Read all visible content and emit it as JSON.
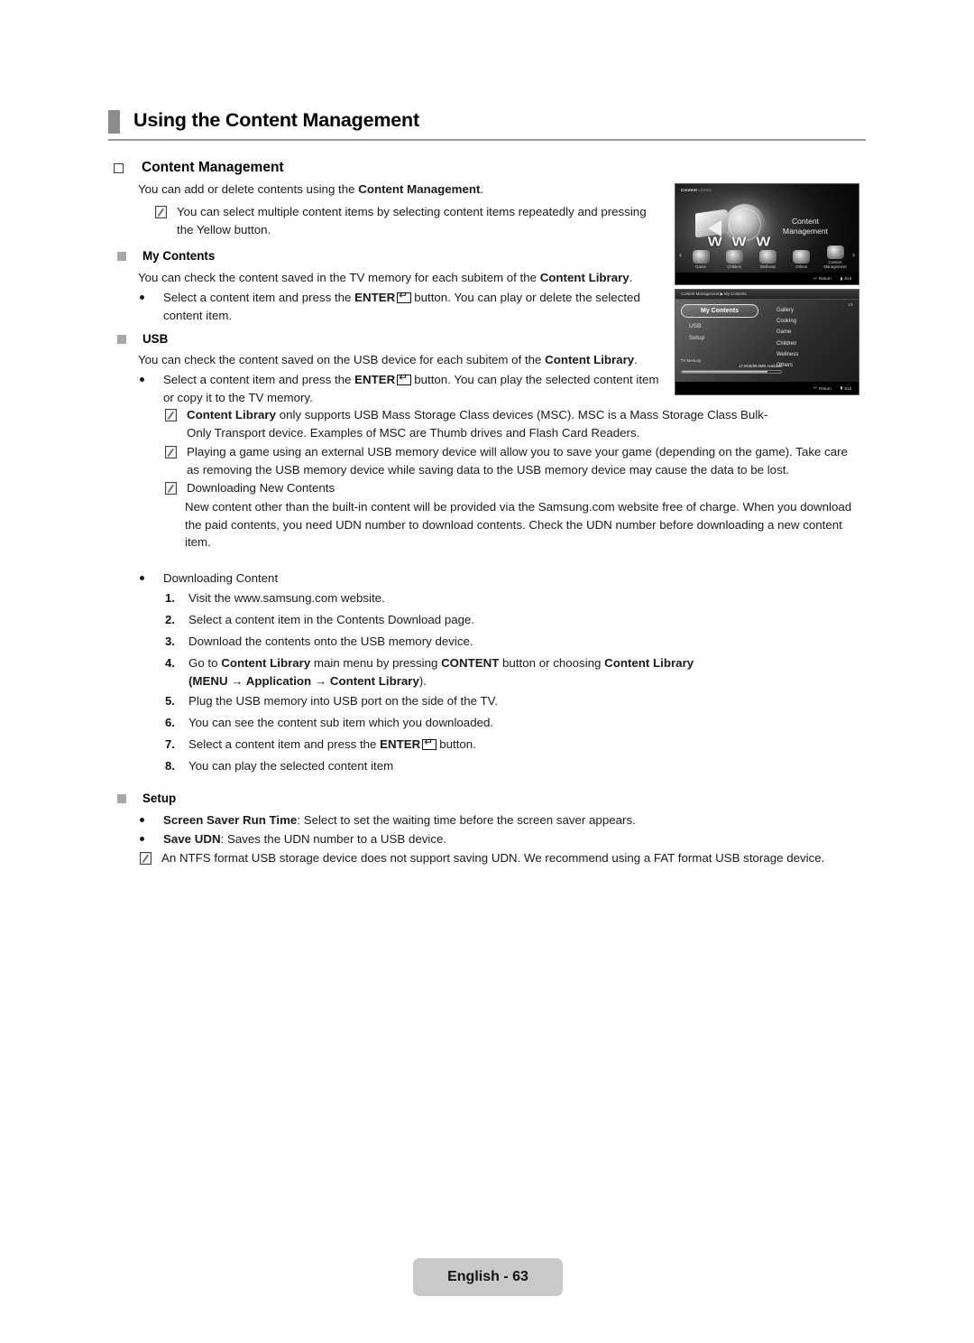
{
  "document": {
    "title": "Using the Content Management",
    "footer_label": "English - 63"
  },
  "section": {
    "heading": "Content Management",
    "intro_prefix": "You can add or delete contents using the ",
    "intro_bold": "Content Management",
    "intro_suffix": ".",
    "note1": "You can select multiple content items by selecting content items repeatedly and pressing the Yellow button."
  },
  "my_contents": {
    "heading": "My Contents",
    "desc_prefix": "You can check the content saved in the TV memory for each subitem of the ",
    "desc_bold": "Content Library",
    "desc_suffix": ".",
    "bullet_pre": "Select a content item and press the ",
    "bullet_enter": "ENTER",
    "bullet_post": "button. You can play or delete the selected content item."
  },
  "usb": {
    "heading": "USB",
    "desc_prefix": "You can check the content saved on the USB device for each subitem of the ",
    "desc_bold": "Content Library",
    "desc_suffix": ".",
    "bullet_pre": "Select a content item and press the ",
    "bullet_enter": "ENTER",
    "bullet_post": "button. You can play the selected content item or copy it to the TV memory.",
    "note_msc_bold": "Content Library",
    "note_msc": " only supports USB Mass Storage Class devices (MSC). MSC is a Mass Storage Class Bulk-Only Transport device. Examples of MSC are Thumb drives and Flash Card Readers.",
    "note_game": "Playing a game using an external USB memory device will allow you to save your game (depending on the game). Take care as removing the USB memory device while saving data to the USB memory device may cause the data to be lost.",
    "note_download_title": "Downloading New Contents",
    "note_download_body": "New content other than the built-in content will be provided via the Samsung.com website free of charge. When you download the paid contents, you need UDN number to download contents. Check the UDN number before downloading a new content item."
  },
  "downloading": {
    "bullet_label": "Downloading Content",
    "steps": [
      {
        "n": "1.",
        "text": "Visit the www.samsung.com website."
      },
      {
        "n": "2.",
        "text": "Select a content item in the Contents Download page."
      },
      {
        "n": "3.",
        "text": "Download the contents onto the USB memory device."
      },
      {
        "n": "4.",
        "text": ""
      },
      {
        "n": "5.",
        "text": "Plug the USB memory into USB port on the side of the TV."
      },
      {
        "n": "6.",
        "text": "You can see the content sub item which you downloaded."
      },
      {
        "n": "7.",
        "text": ""
      },
      {
        "n": "8.",
        "text": "You can play the selected content item"
      }
    ],
    "step4_a": "Go to ",
    "step4_b": "Content Library",
    "step4_c": " main menu by pressing ",
    "step4_d": "CONTENT",
    "step4_e": " button or choosing ",
    "step4_f": "Content Library",
    "step4_g": "(MENU",
    "step4_h": " → Application → Content Library",
    "step4_i": ").",
    "step7_pre": "Select a content item and press the ",
    "step7_enter": "ENTER",
    "step7_post": "button."
  },
  "setup": {
    "heading": "Setup",
    "item1_bold": "Screen Saver Run Time",
    "item1_text": ": Select to set the waiting time before the screen saver appears.",
    "item2_bold": "Save UDN",
    "item2_text": ": Saves the UDN number to a USB device.",
    "note": "An NTFS format USB storage device does not support saving UDN. We recommend using a FAT format USB storage device."
  },
  "tv_screenshot_1": {
    "corner_bold": "Content",
    "corner_dim": "Library",
    "logo_text": "W W W",
    "title_line1": "Content",
    "title_line2": "Management",
    "icons": [
      {
        "label": "Game"
      },
      {
        "label": "Children"
      },
      {
        "label": "Wellness"
      },
      {
        "label": "Others"
      },
      {
        "label": "Content Management"
      }
    ],
    "footer_return": "Return",
    "footer_exit": "Exit",
    "nav_left": "‹",
    "nav_right": "›"
  },
  "tv_screenshot_2": {
    "titlebar": "Content Management ▶ My Contents",
    "page_indicator": "1/1",
    "selected_item": "My Contents",
    "menu_items": [
      "USB",
      "Setup"
    ],
    "content_list": [
      "Gallery",
      "Cooking",
      "Game",
      "Children",
      "Wellness",
      "Others"
    ],
    "memory_label": "TV Memory",
    "memory_value": "17.9GB/89.8MB Available",
    "footer_return": "Return",
    "footer_exit": "Exit"
  }
}
